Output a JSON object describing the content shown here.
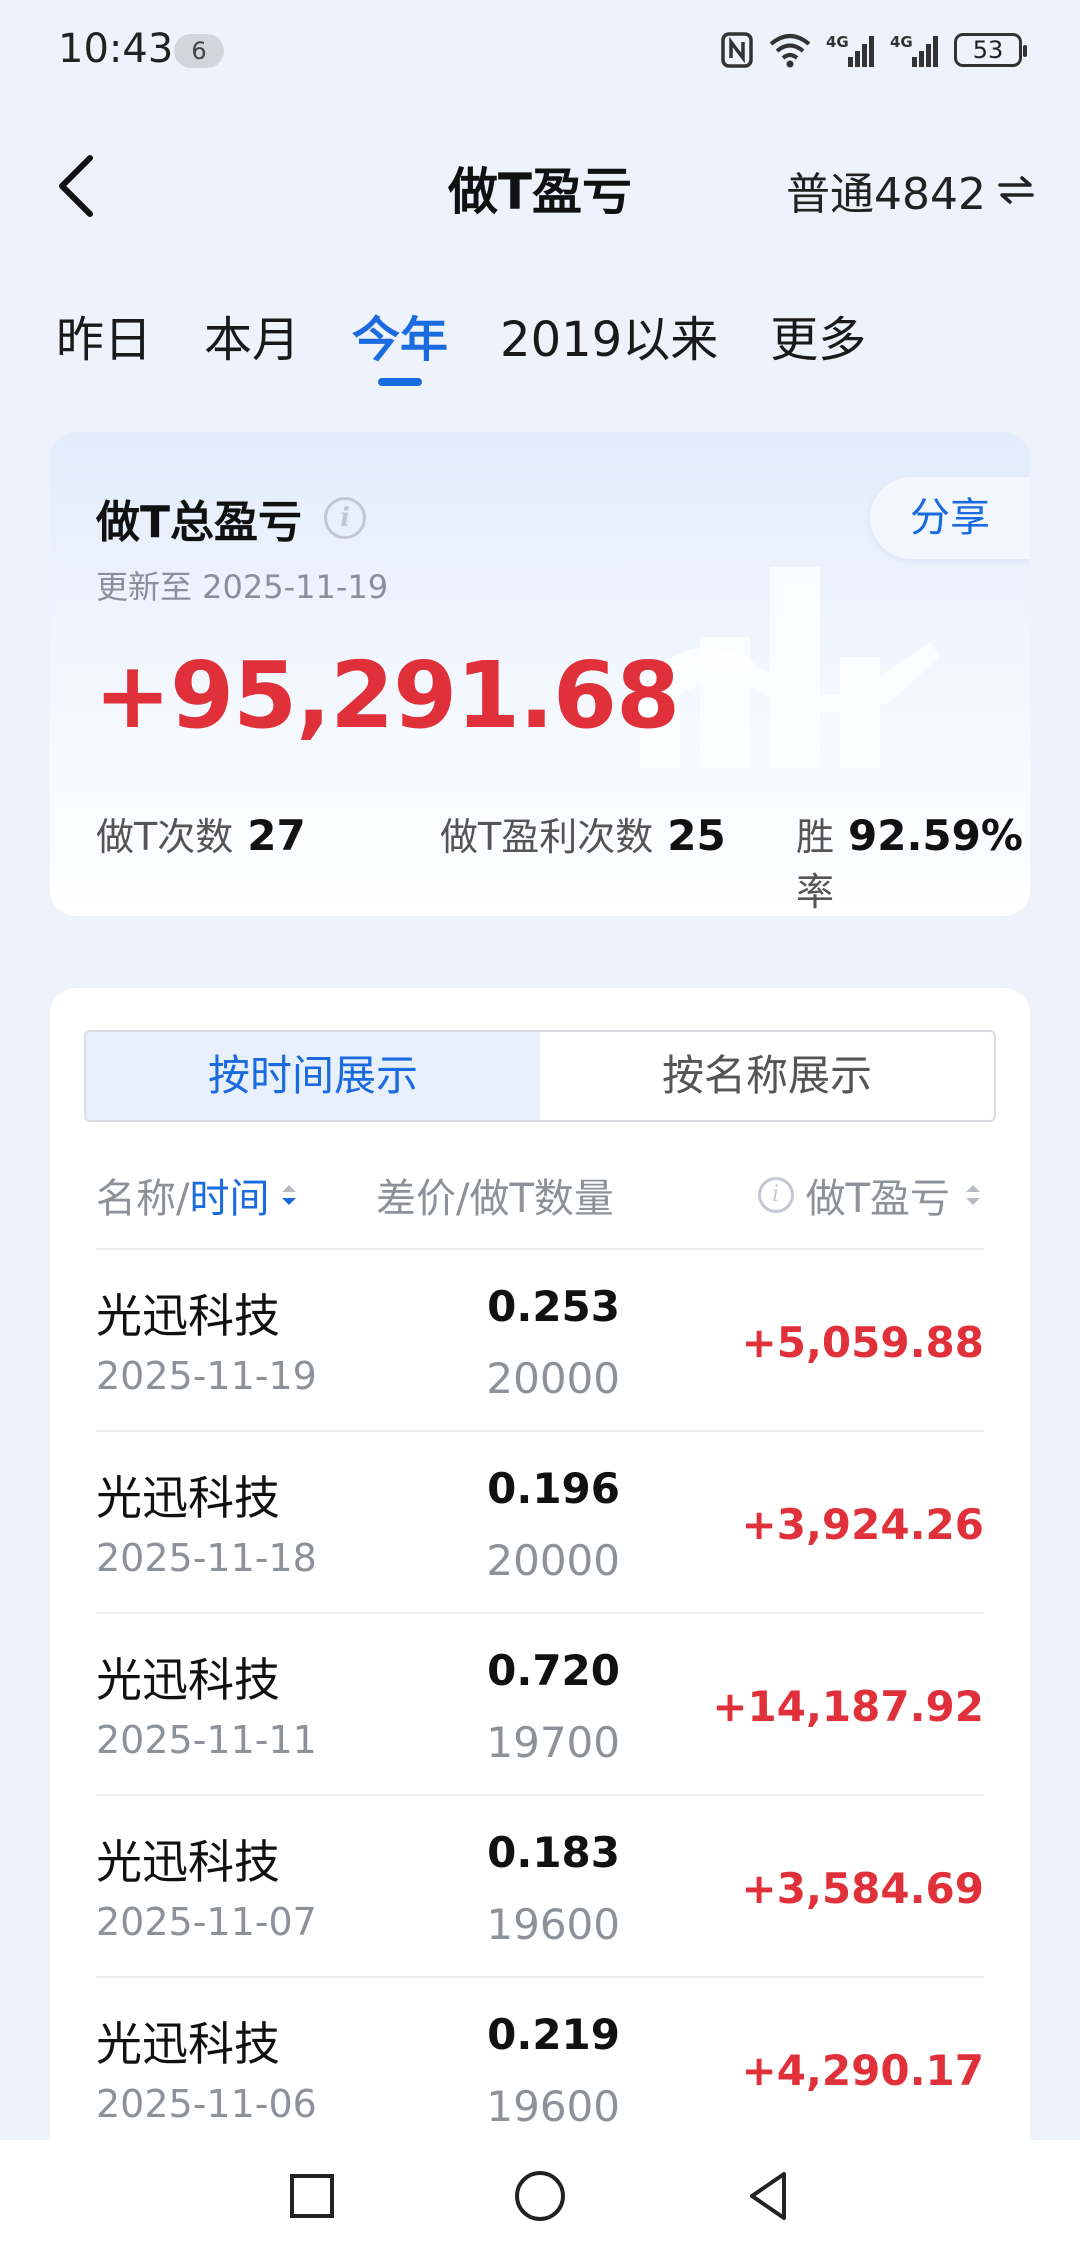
{
  "status_bar": {
    "time": "10:43",
    "notification_count": "6",
    "battery": "53"
  },
  "header": {
    "title": "做T盈亏",
    "account": "普通4842"
  },
  "period_tabs": [
    {
      "label": "昨日",
      "active": false
    },
    {
      "label": "本月",
      "active": false
    },
    {
      "label": "今年",
      "active": true
    },
    {
      "label": "2019以来",
      "active": false
    },
    {
      "label": "更多",
      "active": false
    }
  ],
  "summary": {
    "title": "做T总盈亏",
    "share_label": "分享",
    "updated": "更新至 2025-11-19",
    "total_pnl": "+95,291.68",
    "stats": [
      {
        "label": "做T次数",
        "value": "27"
      },
      {
        "label": "做T盈利次数",
        "value": "25"
      },
      {
        "label": "胜率",
        "value": "92.59%"
      }
    ]
  },
  "view_toggle": {
    "by_time": "按时间展示",
    "by_name": "按名称展示",
    "active": "by_time"
  },
  "table": {
    "col_name": "名称/",
    "col_time": "时间",
    "col_diff": "差价/做T数量",
    "col_pnl": "做T盈亏",
    "rows": [
      {
        "name": "光迅科技",
        "date": "2025-11-19",
        "diff": "0.253",
        "qty": "20000",
        "pnl": "+5,059.88"
      },
      {
        "name": "光迅科技",
        "date": "2025-11-18",
        "diff": "0.196",
        "qty": "20000",
        "pnl": "+3,924.26"
      },
      {
        "name": "光迅科技",
        "date": "2025-11-11",
        "diff": "0.720",
        "qty": "19700",
        "pnl": "+14,187.92"
      },
      {
        "name": "光迅科技",
        "date": "2025-11-07",
        "diff": "0.183",
        "qty": "19600",
        "pnl": "+3,584.69"
      },
      {
        "name": "光迅科技",
        "date": "2025-11-06",
        "diff": "0.219",
        "qty": "19600",
        "pnl": "+4,290.17"
      }
    ]
  },
  "colors": {
    "accent": "#1a6ae0",
    "profit": "#e0313a",
    "background": "#edf2fb"
  }
}
